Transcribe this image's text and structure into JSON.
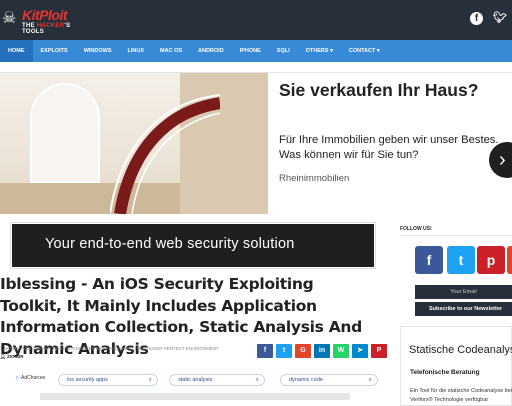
{
  "header": {
    "logo_top": "KitPloit",
    "logo_bottom_a": "THE ",
    "logo_bottom_b": "HACKER",
    "logo_bottom_c": "'S TOOLS",
    "social": [
      "facebook-icon",
      "twitter-icon"
    ]
  },
  "nav": {
    "items": [
      "HOME",
      "EXPLOITS",
      "WINDOWS",
      "LINUX",
      "MAC OS",
      "ANDROID",
      "IPHONE",
      "SQLI",
      "OTHERS ▾",
      "CONTACT ▾"
    ]
  },
  "ad1": {
    "headline": "Sie verkaufen Ihr Haus?",
    "body": "Für Ihre Immobilien geben wir unser Bestes. Was können wir für Sie tun?",
    "source": "Rheinimmobilien",
    "arrow": "›"
  },
  "banner": {
    "text": "Your end-to-end web security solution"
  },
  "post": {
    "title": "Iblessing - An iOS Security Exploiting Toolkit, It Mainly Includes Application Information Collection, Static Analysis And Dynamic Analysis",
    "meta": "1 MONTH AGO  8:30 AM | POST SPONSORED BY FARADAYSEC | MULTIUSER PENTEST ENVIRONMENT",
    "author": "ZION3R"
  },
  "share": {
    "colors": [
      "#3b5998",
      "#1da1f2",
      "#e2442b",
      "#0077b5",
      "#25d366",
      "#0088cc",
      "#cb2027"
    ],
    "labels": [
      "f",
      "t",
      "G",
      "in",
      "W",
      "➤",
      "P"
    ]
  },
  "adbar": {
    "adchoices": "AdChoices",
    "pills": [
      "ios security apps",
      "static analysis",
      "dynamic code"
    ]
  },
  "sidebar": {
    "follow_label": "FOLLOW US!",
    "buttons": [
      {
        "icon": "facebook-icon",
        "glyph": "f",
        "color": "#3b5998"
      },
      {
        "icon": "twitter-icon",
        "glyph": "t",
        "color": "#1da1f2"
      },
      {
        "icon": "pinterest-icon",
        "glyph": "p",
        "color": "#cb2027"
      },
      {
        "icon": "rss-icon",
        "glyph": "r",
        "color": "#e2442b"
      }
    ],
    "email_placeholder": "Your Email",
    "subscribe_label": "Subscribe to our Newsletter",
    "widget_title": "Statische Codeanalyse",
    "widget_sub": "Telefonische Beratung",
    "widget_desc": "Ein Tool für die statische Codeanalyse bei Veriforx® Technologie verfügbar"
  }
}
